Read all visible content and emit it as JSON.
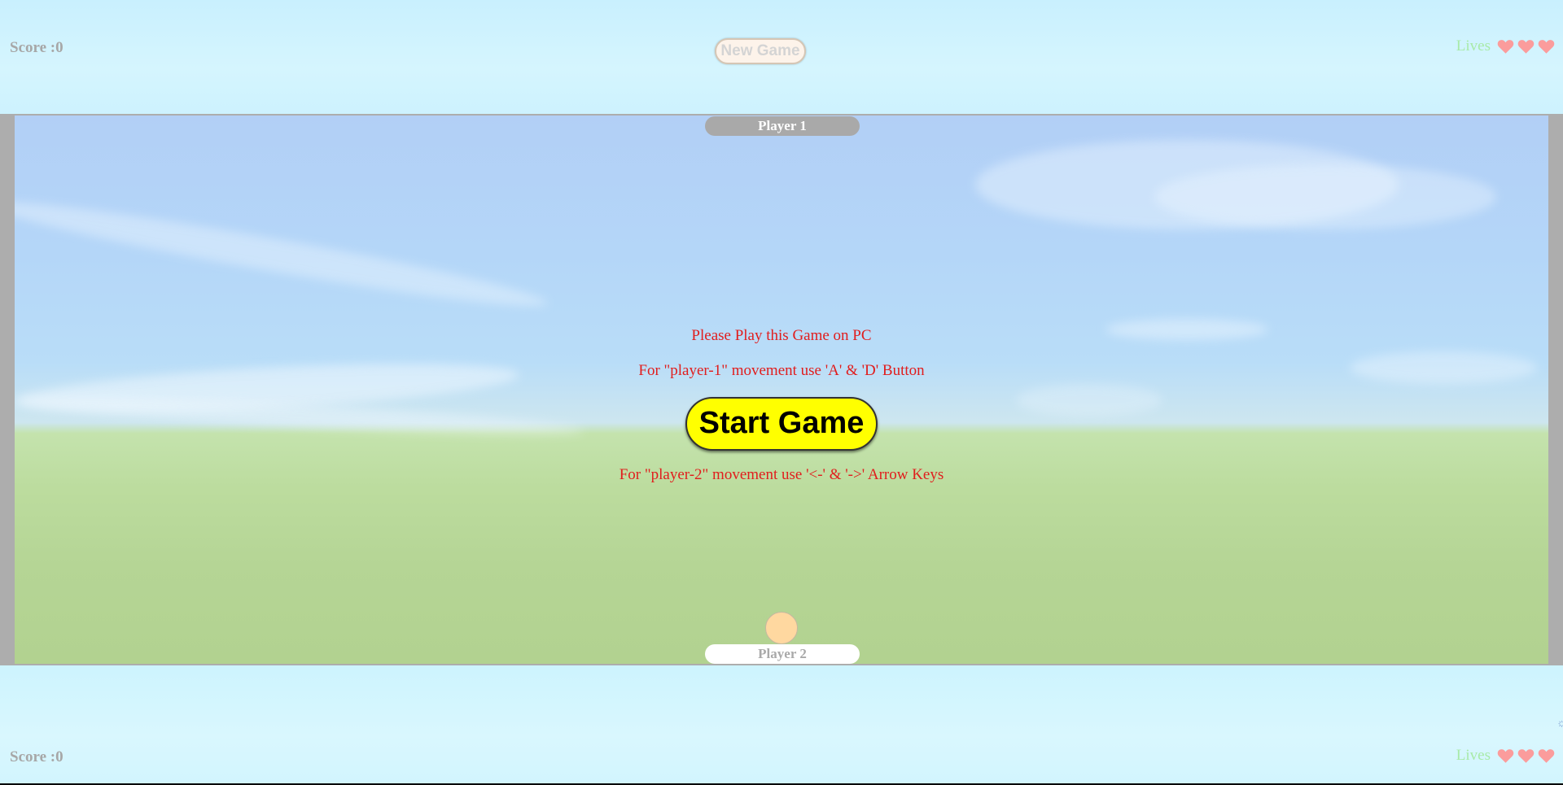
{
  "top_bar": {
    "score_label": "Score :0",
    "new_game_label": "New Game",
    "lives_label": "Lives",
    "lives_count": 3
  },
  "bottom_bar": {
    "score_label": "Score :0",
    "lives_label": "Lives",
    "lives_count": 3
  },
  "game": {
    "player1_label": "Player 1",
    "player2_label": "Player 2",
    "message_pc": "Please Play this Game on PC",
    "message_player1": "For \"player-1\" movement use 'A' & 'D' Button",
    "start_label": "Start Game",
    "message_player2": "For \"player-2\" movement use '<-' & '->' Arrow Keys"
  },
  "colors": {
    "heart": "#fb9c9c",
    "message": "#e11d1d",
    "start_button": "#ffff00",
    "ball": "#ffd8a0"
  },
  "icons": {
    "heart": "heart-icon"
  }
}
